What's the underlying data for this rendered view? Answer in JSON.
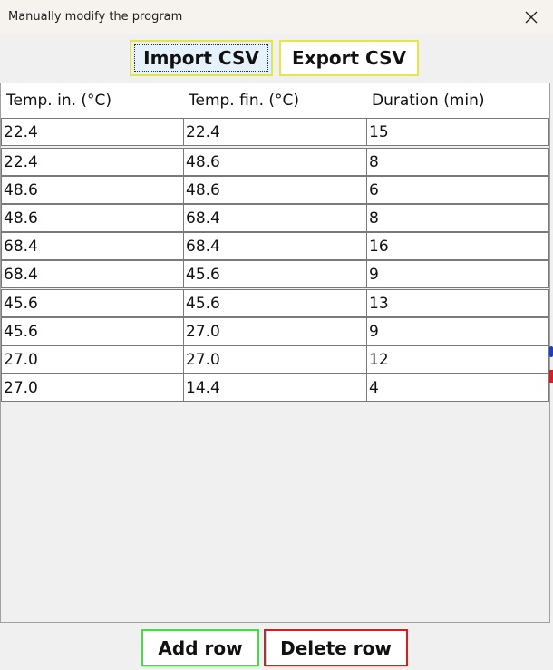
{
  "window": {
    "title": "Manually modify the program",
    "close_icon": "close-icon"
  },
  "toolbar": {
    "import_label": "Import CSV",
    "export_label": "Export CSV"
  },
  "table": {
    "columns": [
      "Temp. in. (°C)",
      "Temp. fin. (°C)",
      "Duration (min)"
    ],
    "rows": [
      [
        "22.4",
        "22.4",
        "15"
      ],
      [
        "22.4",
        "48.6",
        "8"
      ],
      [
        "48.6",
        "48.6",
        "6"
      ],
      [
        "48.6",
        "68.4",
        "8"
      ],
      [
        "68.4",
        "68.4",
        "16"
      ],
      [
        "68.4",
        "45.6",
        "9"
      ],
      [
        "45.6",
        "45.6",
        "13"
      ],
      [
        "45.6",
        "27.0",
        "9"
      ],
      [
        "27.0",
        "27.0",
        "12"
      ],
      [
        "27.0",
        "14.4",
        "4"
      ]
    ]
  },
  "footer": {
    "add_label": "Add row",
    "delete_label": "Delete row"
  },
  "colors": {
    "import_border": "#e3e34a",
    "export_border": "#e6e648",
    "add_border": "#3fe03f",
    "delete_border": "#d71e1e"
  }
}
